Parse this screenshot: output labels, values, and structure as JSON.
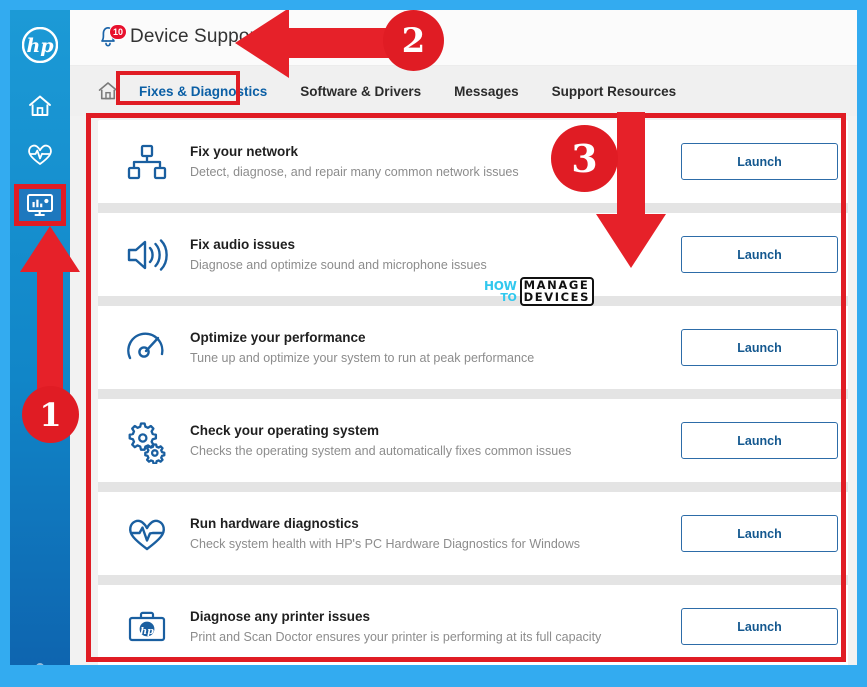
{
  "window": {
    "title": "Device Support",
    "notification_count": "10"
  },
  "sidebar": {
    "brand": "hp",
    "items": [
      {
        "name": "hp-logo",
        "label": "hp"
      },
      {
        "name": "home",
        "label": "Home"
      },
      {
        "name": "health",
        "label": "Health"
      },
      {
        "name": "device-support",
        "label": "Device Support",
        "selected": true
      }
    ]
  },
  "tabs": {
    "home_icon": "home-icon",
    "items": [
      {
        "label": "Fixes & Diagnostics",
        "active": true
      },
      {
        "label": "Software & Drivers",
        "active": false
      },
      {
        "label": "Messages",
        "active": false
      },
      {
        "label": "Support Resources",
        "active": false
      }
    ]
  },
  "list": {
    "rows": [
      {
        "icon": "network-icon",
        "title": "Fix your network",
        "desc": "Detect, diagnose, and repair many common network issues",
        "button": "Launch"
      },
      {
        "icon": "speaker-icon",
        "title": "Fix audio issues",
        "desc": "Diagnose and optimize sound and microphone issues",
        "button": "Launch"
      },
      {
        "icon": "gauge-icon",
        "title": "Optimize your performance",
        "desc": "Tune up and optimize your system to run at peak performance",
        "button": "Launch"
      },
      {
        "icon": "gears-icon",
        "title": "Check your operating system",
        "desc": "Checks the operating system and automatically fixes common issues",
        "button": "Launch"
      },
      {
        "icon": "heartbeat-icon",
        "title": "Run hardware diagnostics",
        "desc": "Check system health with HP's PC Hardware Diagnostics for Windows",
        "button": "Launch"
      },
      {
        "icon": "printer-toolkit-icon",
        "title": "Diagnose any printer issues",
        "desc": "Print and Scan Doctor ensures your printer is performing at its full capacity",
        "button": "Launch"
      }
    ]
  },
  "annotations": {
    "badges": [
      {
        "id": "1",
        "label": "1"
      },
      {
        "id": "2",
        "label": "2"
      },
      {
        "id": "3",
        "label": "3"
      }
    ],
    "color": "#E01C24"
  },
  "watermark": {
    "line1": "HOW",
    "line2": "TO",
    "line3": "MANAGE",
    "line4": "DEVICES"
  },
  "colors": {
    "accent_blue": "#0B5FA5",
    "rail_blue": "#1186C8",
    "annotation_red": "#E01C24",
    "outer_blue": "#33ABF0",
    "button_border": "#2D6CA8"
  }
}
